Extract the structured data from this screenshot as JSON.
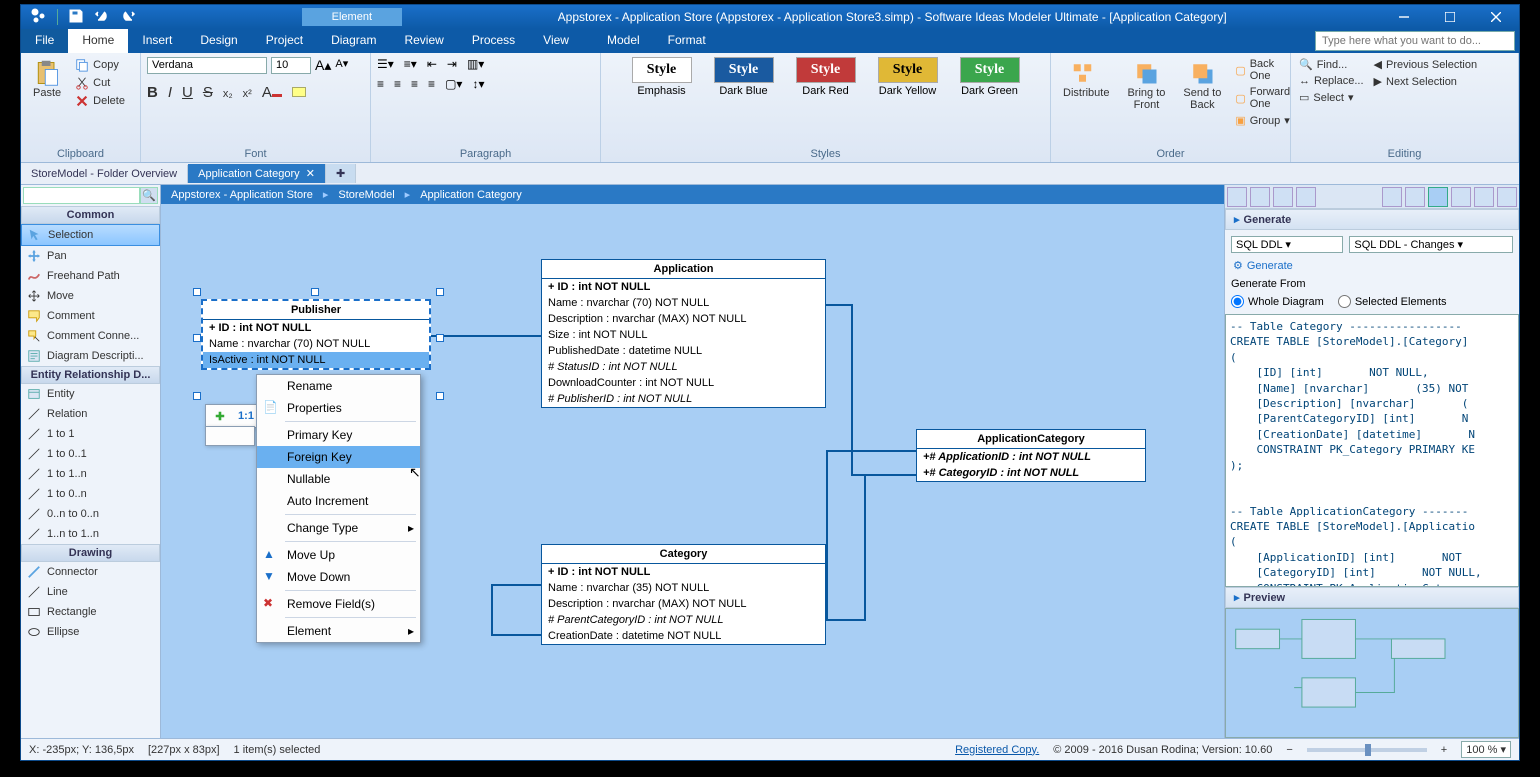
{
  "window": {
    "ctxtab": "Element",
    "title": "Appstorex - Application Store (Appstorex - Application Store3.simp)  - Software Ideas Modeler Ultimate - [Application Category]"
  },
  "menu": {
    "items": [
      "File",
      "Home",
      "Insert",
      "Design",
      "Project",
      "Diagram",
      "Review",
      "Process",
      "View",
      "Model",
      "Format"
    ],
    "active": "Home",
    "tellme": "Type here what you want to do..."
  },
  "ribbon": {
    "clipboard": {
      "title": "Clipboard",
      "paste": "Paste",
      "copy": "Copy",
      "cut": "Cut",
      "delete": "Delete"
    },
    "font": {
      "title": "Font",
      "family": "Verdana",
      "size": "10"
    },
    "paragraph": {
      "title": "Paragraph"
    },
    "styles": {
      "title": "Styles",
      "items": [
        {
          "label": "Emphasis",
          "bg": "#fff",
          "fg": "#333"
        },
        {
          "label": "Dark Blue",
          "bg": "#1a5aa0",
          "fg": "#fff"
        },
        {
          "label": "Dark Red",
          "bg": "#c13a3a",
          "fg": "#fff"
        },
        {
          "label": "Dark Yellow",
          "bg": "#e0b836",
          "fg": "#333"
        },
        {
          "label": "Dark Green",
          "bg": "#3ba64d",
          "fg": "#fff"
        }
      ]
    },
    "order": {
      "title": "Order",
      "distribute": "Distribute",
      "btf": "Bring to\nFront",
      "stb": "Send to\nBack",
      "backone": "Back One",
      "fwdone": "Forward One",
      "group": "Group"
    },
    "editing": {
      "title": "Editing",
      "find": "Find...",
      "replace": "Replace...",
      "select": "Select",
      "prevsel": "Previous Selection",
      "nextsel": "Next Selection"
    }
  },
  "tabs": {
    "inactive": "StoreModel - Folder Overview",
    "active": "Application Category"
  },
  "breadcrumb": [
    "Appstorex - Application Store",
    "StoreModel",
    "Application Category"
  ],
  "sidebar": {
    "common": {
      "title": "Common",
      "items": [
        "Selection",
        "Pan",
        "Freehand Path",
        "Move",
        "Comment",
        "Comment Conne...",
        "Diagram Descripti..."
      ]
    },
    "er": {
      "title": "Entity Relationship D...",
      "items": [
        "Entity",
        "Relation",
        "1 to 1",
        "1 to 0..1",
        "1 to 1..n",
        "1 to 0..n",
        "0..n to 0..n",
        "1..n to 1..n"
      ]
    },
    "drawing": {
      "title": "Drawing",
      "items": [
        "Connector",
        "Line",
        "Rectangle",
        "Ellipse"
      ]
    }
  },
  "entities": {
    "publisher": {
      "title": "Publisher",
      "fields": [
        "+ ID : int NOT NULL",
        "Name : nvarchar (70)  NOT NULL",
        "IsActive : int NOT NULL"
      ]
    },
    "application": {
      "title": "Application",
      "fields": [
        "+ ID : int NOT NULL",
        "Name : nvarchar (70)  NOT NULL",
        "Description : nvarchar (MAX)  NOT NULL",
        "Size : int NOT NULL",
        "PublishedDate : datetime NULL",
        "# StatusID : int NOT NULL",
        "DownloadCounter : int NOT NULL",
        "# PublisherID : int NOT NULL"
      ]
    },
    "appcat": {
      "title": "ApplicationCategory",
      "fields": [
        "+# ApplicationID : int NOT NULL",
        "+# CategoryID : int NOT NULL"
      ]
    },
    "category": {
      "title": "Category",
      "fields": [
        "+ ID : int NOT NULL",
        "Name : nvarchar (35)  NOT NULL",
        "Description : nvarchar (MAX)  NOT NULL",
        "# ParentCategoryID : int NOT NULL",
        "CreationDate : datetime NOT NULL"
      ]
    }
  },
  "ctxmenu": {
    "items": [
      "Rename",
      "Properties",
      "Primary Key",
      "Foreign Key",
      "Nullable",
      "Auto Increment",
      "Change Type",
      "Move Up",
      "Move Down",
      "Remove Field(s)",
      "Element"
    ],
    "hover": "Foreign Key"
  },
  "floattb": {
    "label": "1:1"
  },
  "rpanel": {
    "generate": {
      "title": "Generate",
      "dd1": "SQL DDL",
      "dd2": "SQL DDL - Changes",
      "link": "Generate",
      "from": "Generate From",
      "r1": "Whole Diagram",
      "r2": "Selected Elements"
    },
    "sql": "-- Table Category -----------------\nCREATE TABLE [StoreModel].[Category]\n(\n    [ID] [int]       NOT NULL,\n    [Name] [nvarchar]       (35) NOT\n    [Description] [nvarchar]       (\n    [ParentCategoryID] [int]       N\n    [CreationDate] [datetime]       N\n    CONSTRAINT PK_Category PRIMARY KE\n);\n\n\n-- Table ApplicationCategory -------\nCREATE TABLE [StoreModel].[Applicatio\n(\n    [ApplicationID] [int]       NOT \n    [CategoryID] [int]       NOT NULL,\n    CONSTRAINT PK ApplicationCategory",
    "preview": "Preview"
  },
  "status": {
    "coords": "X: -235px; Y: 136,5px",
    "size": "[227px x 83px]",
    "sel": "1 item(s) selected",
    "reg": "Registered Copy.",
    "copyright": "© 2009 - 2016 Dusan Rodina; Version: 10.60",
    "zoom": "100 %"
  }
}
